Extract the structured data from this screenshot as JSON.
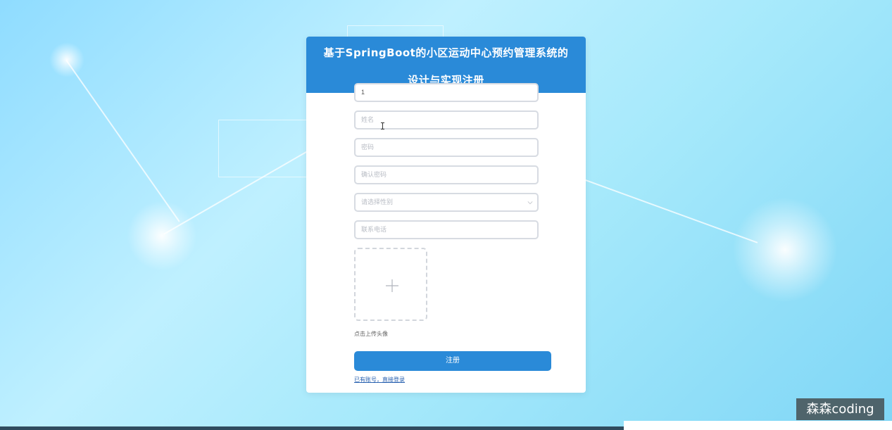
{
  "form": {
    "title_line1": "基于SpringBoot的小区运动中心预约管理系统的",
    "title_line2": "设计与实现注册",
    "account_value": "1",
    "name_placeholder": "姓名",
    "password_placeholder": "密码",
    "confirm_password_placeholder": "确认密码",
    "gender_placeholder": "请选择性别",
    "phone_placeholder": "联系电话",
    "upload_label": "点击上传头像",
    "register_label": "注册",
    "login_link": "已有账号，直接登录"
  },
  "watermark": "森森coding",
  "colors": {
    "accent": "#2a8ad8",
    "background": "#a6e9fb"
  },
  "icons": [
    "chevron-down-icon",
    "plus-icon",
    "text-cursor-icon"
  ]
}
